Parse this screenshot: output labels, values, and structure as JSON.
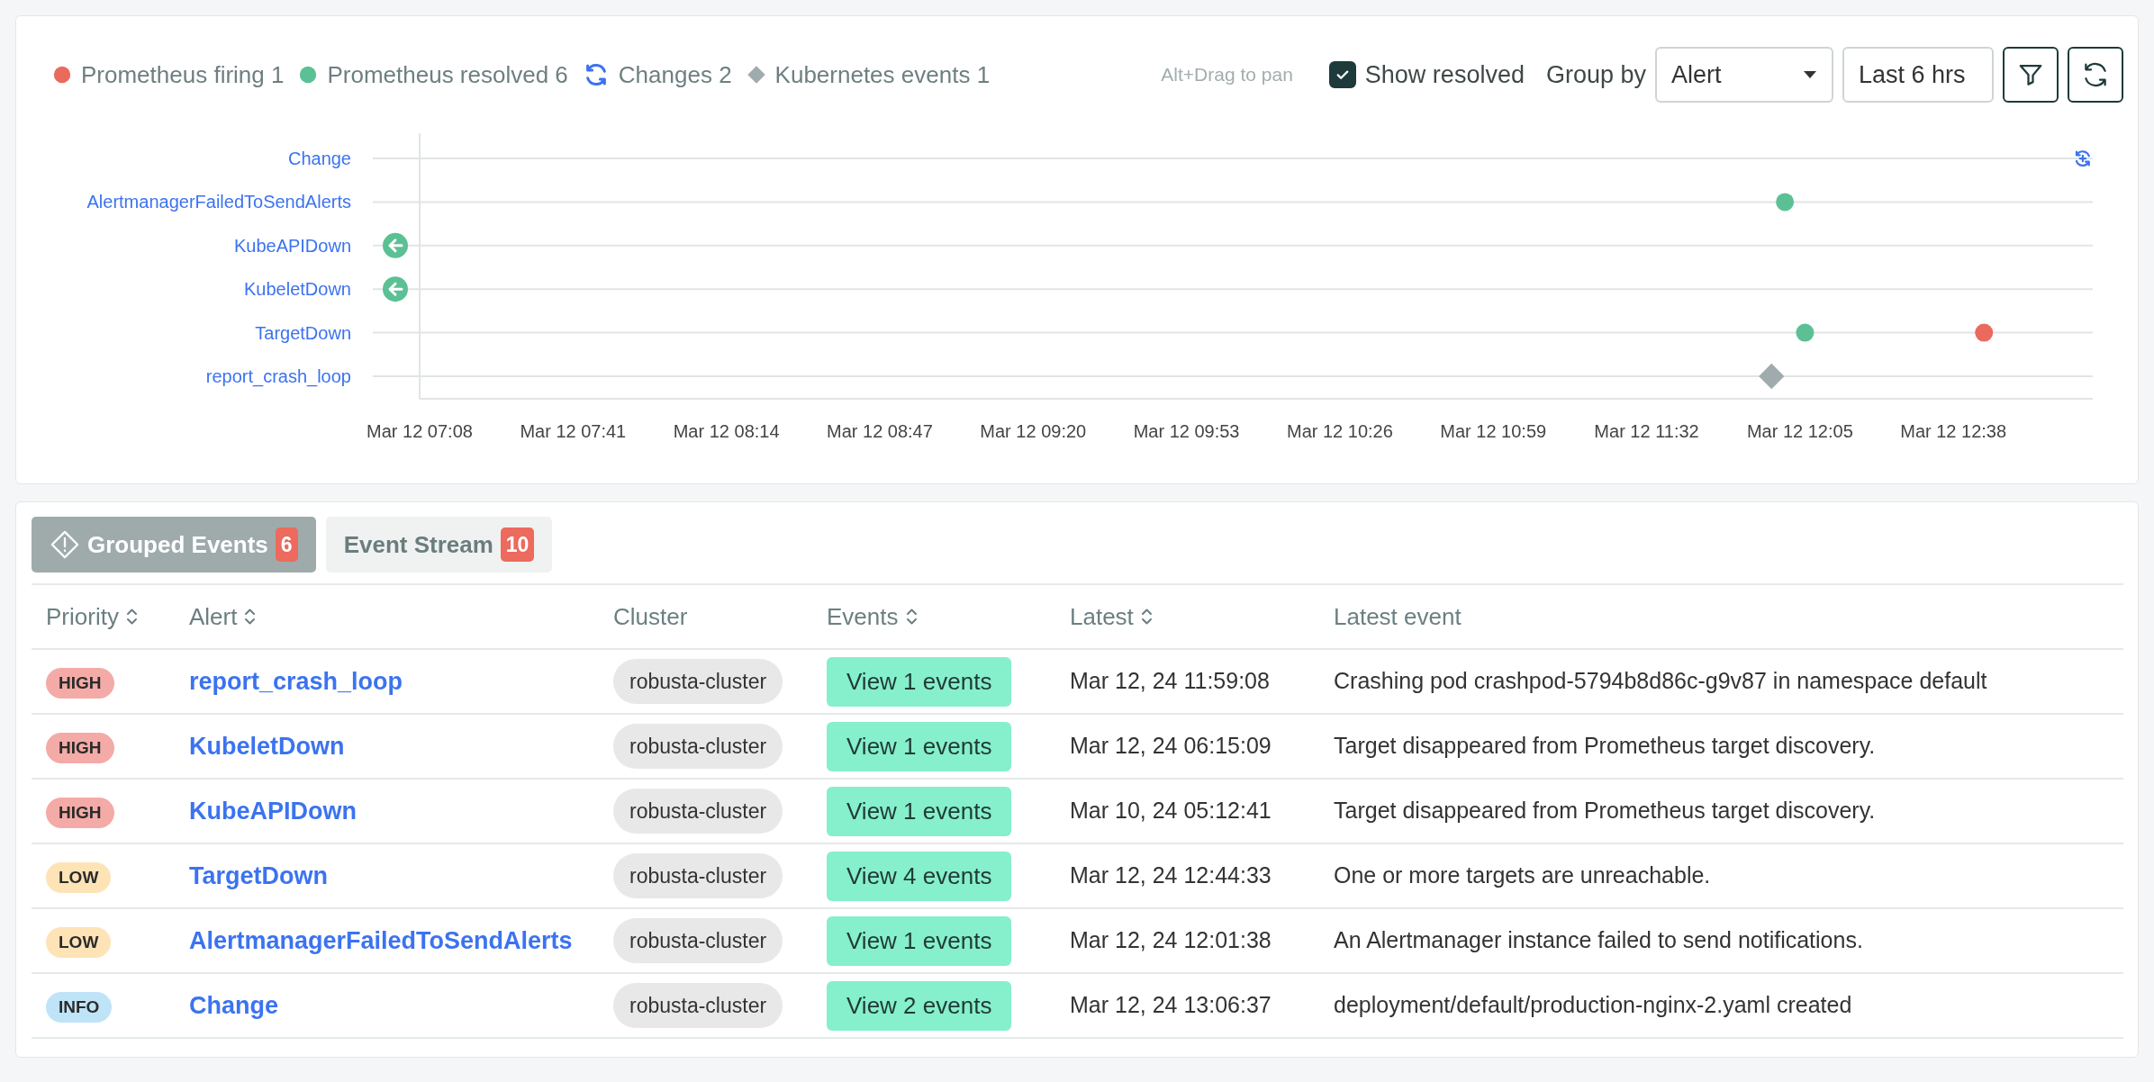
{
  "toolbar": {
    "hint": "Alt+Drag to pan",
    "show_resolved": {
      "label": "Show resolved",
      "checked": true
    },
    "group_by": {
      "label": "Group by",
      "value": "Alert"
    },
    "time_range": {
      "value": "Last 6 hrs"
    }
  },
  "timeline": {
    "legend": [
      {
        "label": "Prometheus firing",
        "count": "1",
        "kind": "dot",
        "color": "#ea6a5e"
      },
      {
        "label": "Prometheus resolved",
        "count": "6",
        "kind": "dot",
        "color": "#5cc095"
      },
      {
        "label": "Changes",
        "count": "2",
        "kind": "change",
        "color": "#3b73f0"
      },
      {
        "label": "Kubernetes events",
        "count": "1",
        "kind": "diamond",
        "color": "#a0abae"
      }
    ],
    "rows": [
      {
        "label": "Change",
        "events": [
          {
            "kind": "change",
            "color": "#3b73f0",
            "level": 0.994
          }
        ]
      },
      {
        "label": "AlertmanagerFailedToSendAlerts",
        "events": [
          {
            "kind": "dot",
            "color": "#5cc095",
            "level": 0.816
          }
        ]
      },
      {
        "label": "KubeAPIDown",
        "events": [
          {
            "kind": "earlier",
            "color": "#5cc095"
          }
        ]
      },
      {
        "label": "KubeletDown",
        "events": [
          {
            "kind": "earlier",
            "color": "#5cc095"
          }
        ]
      },
      {
        "label": "TargetDown",
        "events": [
          {
            "kind": "dot",
            "color": "#5cc095",
            "level": 0.828
          },
          {
            "kind": "dot",
            "color": "#ea6a5e",
            "level": 0.935
          }
        ]
      },
      {
        "label": "report_crash_loop",
        "events": [
          {
            "kind": "diamond",
            "color": "#a0abae",
            "level": 0.808
          }
        ]
      }
    ],
    "ticks": [
      "Mar 12 07:08",
      "Mar 12 07:41",
      "Mar 12 08:14",
      "Mar 12 08:47",
      "Mar 12 09:20",
      "Mar 12 09:53",
      "Mar 12 10:26",
      "Mar 12 10:59",
      "Mar 12 11:32",
      "Mar 12 12:05",
      "Mar 12 12:38"
    ]
  },
  "tabs": [
    {
      "label": "Grouped Events",
      "count": "6",
      "selected": true,
      "has_icon": true
    },
    {
      "label": "Event Stream",
      "count": "10",
      "selected": false,
      "has_icon": false
    }
  ],
  "table": {
    "columns": [
      {
        "label": "Priority",
        "sortable": true
      },
      {
        "label": "Alert",
        "sortable": true
      },
      {
        "label": "Cluster",
        "sortable": false
      },
      {
        "label": "Events",
        "sortable": true
      },
      {
        "label": "Latest",
        "sortable": true
      },
      {
        "label": "Latest event",
        "sortable": false
      }
    ],
    "rows": [
      {
        "priority": {
          "label": "HIGH",
          "kind": "high"
        },
        "alert": "report_crash_loop",
        "cluster": "robusta-cluster",
        "events": "View 1 events",
        "latest": "Mar 12, 24 11:59:08",
        "latest_event": "Crashing pod crashpod-5794b8d86c-g9v87 in namespace default"
      },
      {
        "priority": {
          "label": "HIGH",
          "kind": "high"
        },
        "alert": "KubeletDown",
        "cluster": "robusta-cluster",
        "events": "View 1 events",
        "latest": "Mar 12, 24 06:15:09",
        "latest_event": "Target disappeared from Prometheus target discovery."
      },
      {
        "priority": {
          "label": "HIGH",
          "kind": "high"
        },
        "alert": "KubeAPIDown",
        "cluster": "robusta-cluster",
        "events": "View 1 events",
        "latest": "Mar 10, 24 05:12:41",
        "latest_event": "Target disappeared from Prometheus target discovery."
      },
      {
        "priority": {
          "label": "LOW",
          "kind": "low"
        },
        "alert": "TargetDown",
        "cluster": "robusta-cluster",
        "events": "View 4 events",
        "latest": "Mar 12, 24 12:44:33",
        "latest_event": "One or more targets are unreachable."
      },
      {
        "priority": {
          "label": "LOW",
          "kind": "low"
        },
        "alert": "AlertmanagerFailedToSendAlerts",
        "cluster": "robusta-cluster",
        "events": "View 1 events",
        "latest": "Mar 12, 24 12:01:38",
        "latest_event": "An Alertmanager instance failed to send notifications."
      },
      {
        "priority": {
          "label": "INFO",
          "kind": "info"
        },
        "alert": "Change",
        "cluster": "robusta-cluster",
        "events": "View 2 events",
        "latest": "Mar 12, 24 13:06:37",
        "latest_event": "deployment/default/production-nginx-2.yaml created"
      }
    ]
  }
}
